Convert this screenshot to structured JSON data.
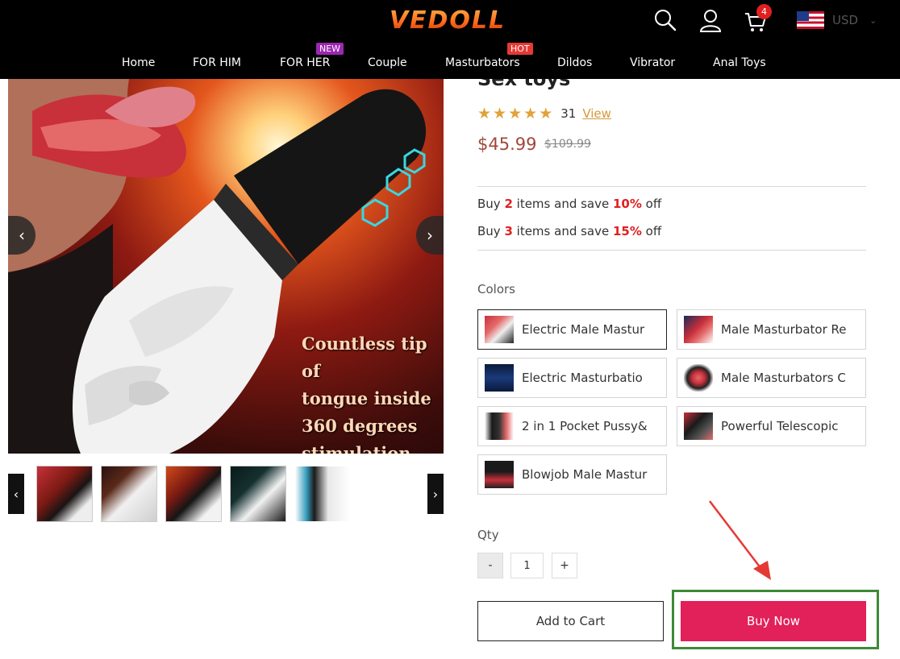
{
  "header": {
    "logo": "VEDOLL",
    "icons": [
      "search-icon",
      "user-icon",
      "cart-icon"
    ],
    "cart_count": "4",
    "currency": "USD"
  },
  "nav": [
    {
      "label": "Home"
    },
    {
      "label": "FOR HIM"
    },
    {
      "label": "FOR HER",
      "badge": "NEW"
    },
    {
      "label": "Couple"
    },
    {
      "label": "Masturbators",
      "badge": "HOT"
    },
    {
      "label": "Dildos"
    },
    {
      "label": "Vibrator"
    },
    {
      "label": "Anal Toys"
    }
  ],
  "gallery": {
    "overlay_lines": [
      "Countless tip of",
      "tongue inside",
      "360 degrees",
      "stimulation"
    ],
    "thumbnail_count": 5
  },
  "product": {
    "title": "Sex toys",
    "rating": 5,
    "review_count": "31",
    "review_link": "View",
    "price": "$45.99",
    "old_price": "$109.99"
  },
  "offers": [
    {
      "prefix": "Buy ",
      "qty": "2",
      "middle": " items and save ",
      "percent": "10%",
      "suffix": " off"
    },
    {
      "prefix": "Buy ",
      "qty": "3",
      "middle": " items and save ",
      "percent": "15%",
      "suffix": " off"
    }
  ],
  "colors": {
    "label": "Colors",
    "options": [
      {
        "label": "Electric Male Mastur",
        "selected": true
      },
      {
        "label": "Male Masturbator Re",
        "selected": false
      },
      {
        "label": "Electric Masturbatio",
        "selected": false
      },
      {
        "label": "Male Masturbators C",
        "selected": false
      },
      {
        "label": "2 in 1 Pocket Pussy&",
        "selected": false
      },
      {
        "label": "Powerful Telescopic",
        "selected": false
      },
      {
        "label": "Blowjob Male Mastur",
        "selected": false
      }
    ]
  },
  "qty": {
    "label": "Qty",
    "minus": "-",
    "value": "1",
    "plus": "+"
  },
  "actions": {
    "add_to_cart": "Add to Cart",
    "buy_now": "Buy Now"
  },
  "colors_theme": {
    "buy_now": "#e2205a",
    "highlight_box": "#3e8a36",
    "annotation_arrow": "#e53935",
    "price": "#a0483a",
    "offer_highlight": "#e02020",
    "stars": "#e0a23a"
  }
}
